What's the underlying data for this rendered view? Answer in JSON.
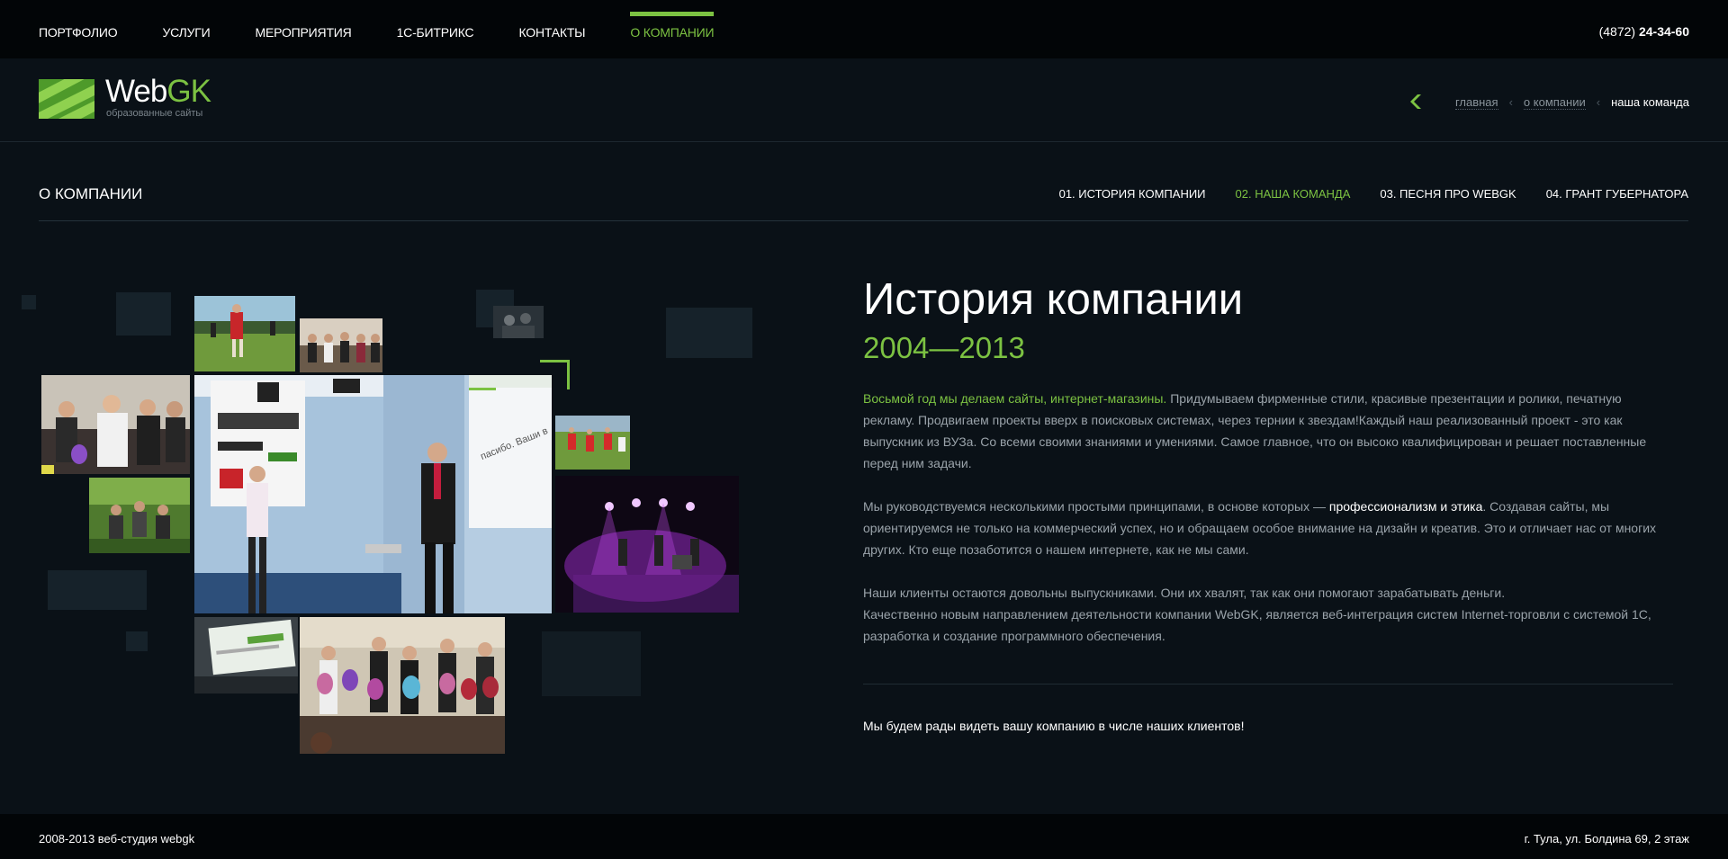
{
  "topnav": {
    "items": [
      {
        "label": "ПОРТФОЛИО"
      },
      {
        "label": "УСЛУГИ"
      },
      {
        "label": "МЕРОПРИЯТИЯ"
      },
      {
        "label": "1С-БИТРИКС"
      },
      {
        "label": "КОНТАКТЫ"
      },
      {
        "label": "О КОМПАНИИ",
        "active": true
      }
    ],
    "phone_code": "(4872)",
    "phone_number": "24-34-60"
  },
  "logo": {
    "web": "Web",
    "gk": "GK",
    "tagline": "образованные сайты"
  },
  "breadcrumb": {
    "home": "главная",
    "parent": "о компании",
    "current": "наша команда",
    "separator": "‹"
  },
  "section": {
    "title": "О КОМПАНИИ",
    "subnav": [
      {
        "label": "01. ИСТОРИЯ КОМПАНИИ"
      },
      {
        "label": "02. НАША КОМАНДА",
        "active": true
      },
      {
        "label": "03. ПЕСНЯ ПРО WEBGK"
      },
      {
        "label": "04. ГРАНТ ГУБЕРНАТОРА"
      }
    ]
  },
  "content": {
    "heading": "История компании",
    "years": "2004—2013",
    "p1_green": "Восьмой год мы делаем сайты, интернет-магазины.",
    "p1_rest": " Придумываем фирменные стили, красивые презентации и ролики, печатную рекламу. Продвигаем проекты вверх в поисковых системах, через тернии к звездам!Каждый наш реализованный проект - это как выпускник из ВУЗа. Со всеми своими знаниями и умениями. Самое главное, что он высоко квалифицирован и решает поставленные перед ним задачи.",
    "p2_start": "Мы руководствуемся несколькими простыми принципами, в основе которых — ",
    "p2_white": "профессионализм и этика",
    "p2_rest": ". Создавая сайты, мы ориентируемся не только на коммерческий успех, но и обращаем особое внимание на дизайн и креатив. Это и отличает нас от многих других. Кто еще позаботится о нашем интернете, как не мы сами.",
    "p3_line1": "Наши клиенты остаются довольны выпускниками. Они их хвалят, так как они помогают зарабатывать деньги.",
    "p3_line2": "Качественно новым направлением деятельности компании WebGK, является веб-интеграция систем Internet-торговли с системой 1С, разработка и создание программного обеспечения.",
    "cta": "Мы будем рады видеть вашу компанию в числе наших клиентов!"
  },
  "collage": {
    "photos": [
      {
        "name": "football-photo"
      },
      {
        "name": "group-event-photo"
      },
      {
        "name": "party-photo"
      },
      {
        "name": "presentation-photo"
      },
      {
        "name": "outdoor-group-photo"
      },
      {
        "name": "soccer-team-photo"
      },
      {
        "name": "concert-photo"
      },
      {
        "name": "laptop-photo"
      },
      {
        "name": "balloons-photo"
      },
      {
        "name": "small-dark-photo"
      }
    ]
  },
  "footer": {
    "copyright": "2008-2013 веб-студия webgk",
    "address": "г. Тула, ул. Болдина 69, 2 этаж"
  },
  "colors": {
    "accent": "#7cc242",
    "background": "#0a1117",
    "bar": "#020507"
  }
}
